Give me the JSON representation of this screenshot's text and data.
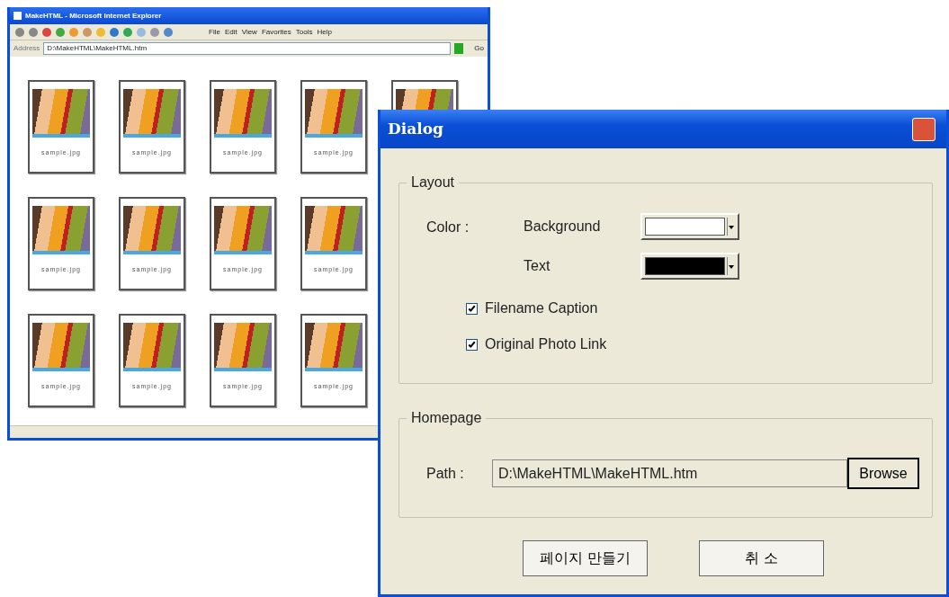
{
  "browser": {
    "title": "MakeHTML - Microsoft Internet Explorer",
    "menu": [
      "File",
      "Edit",
      "View",
      "Favorites",
      "Tools",
      "Help"
    ],
    "address_label": "Address",
    "address": "D:\\MakeHTML\\MakeHTML.htm",
    "go": "Go",
    "thumbnail_rows": [
      [
        {
          "caption": "sample.jpg"
        },
        {
          "caption": "sample.jpg"
        },
        {
          "caption": "sample.jpg"
        },
        {
          "caption": "sample.jpg"
        },
        {}
      ],
      [
        {
          "caption": "sample.jpg"
        },
        {
          "caption": "sample.jpg"
        },
        {
          "caption": "sample.jpg"
        },
        {
          "caption": "sample.jpg"
        }
      ],
      [
        {
          "caption": "sample.jpg"
        },
        {
          "caption": "sample.jpg"
        },
        {
          "caption": "sample.jpg"
        },
        {
          "caption": "sample.jpg"
        }
      ]
    ]
  },
  "dialog": {
    "title": "Dialog",
    "layout_group": {
      "legend": "Layout",
      "color_label": "Color :",
      "colors": [
        {
          "label": "Background",
          "color": "#ffffff"
        },
        {
          "label": "Text",
          "color": "#000000"
        }
      ],
      "checkboxes": [
        {
          "label": "Filename Caption",
          "checked": true
        },
        {
          "label": "Original Photo Link",
          "checked": true
        }
      ]
    },
    "homepage_group": {
      "legend": "Homepage",
      "path_label": "Path :",
      "path": "D:\\MakeHTML\\MakeHTML.htm",
      "browse": "Browse"
    },
    "buttons": [
      "페이지 만들기",
      "취 소"
    ]
  }
}
